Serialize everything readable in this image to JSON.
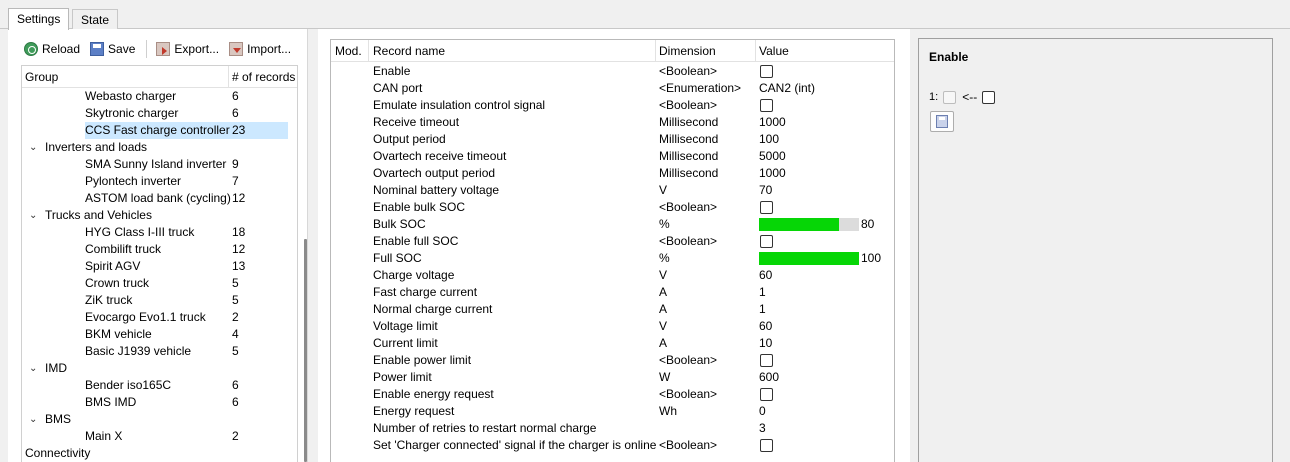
{
  "tabs": [
    {
      "label": "Settings",
      "active": true
    },
    {
      "label": "State",
      "active": false
    }
  ],
  "toolbar": {
    "reload": "Reload",
    "save": "Save",
    "export": "Export...",
    "import": "Import..."
  },
  "tree": {
    "col_group": "Group",
    "col_count": "# of records",
    "rows": [
      {
        "level": 2,
        "label": "Webasto charger",
        "count": "6"
      },
      {
        "level": 2,
        "label": "Skytronic charger",
        "count": "6"
      },
      {
        "level": 2,
        "label": "CCS Fast charge controller",
        "count": "23",
        "selected": true
      },
      {
        "level": 1,
        "label": "Inverters and loads",
        "count": "",
        "expanded": true
      },
      {
        "level": 2,
        "label": "SMA Sunny Island inverter",
        "count": "9"
      },
      {
        "level": 2,
        "label": "Pylontech inverter",
        "count": "7"
      },
      {
        "level": 2,
        "label": "ASTOM load bank (cycling)",
        "count": "12"
      },
      {
        "level": 1,
        "label": "Trucks and Vehicles",
        "count": "",
        "expanded": true
      },
      {
        "level": 2,
        "label": "HYG Class I-III truck",
        "count": "18"
      },
      {
        "level": 2,
        "label": "Combilift truck",
        "count": "12"
      },
      {
        "level": 2,
        "label": "Spirit AGV",
        "count": "13"
      },
      {
        "level": 2,
        "label": "Crown truck",
        "count": "5"
      },
      {
        "level": 2,
        "label": "ZiK truck",
        "count": "5"
      },
      {
        "level": 2,
        "label": "Evocargo Evo1.1 truck",
        "count": "2"
      },
      {
        "level": 2,
        "label": "BKM vehicle",
        "count": "4"
      },
      {
        "level": 2,
        "label": "Basic J1939 vehicle",
        "count": "5"
      },
      {
        "level": 1,
        "label": "IMD",
        "count": "",
        "expanded": true
      },
      {
        "level": 2,
        "label": "Bender iso165C",
        "count": "6"
      },
      {
        "level": 2,
        "label": "BMS IMD",
        "count": "6"
      },
      {
        "level": 1,
        "label": "BMS",
        "count": "",
        "expanded": true
      },
      {
        "level": 2,
        "label": "Main X",
        "count": "2"
      },
      {
        "level": 0,
        "label": "Connectivity",
        "count": "",
        "expanded": true
      }
    ]
  },
  "grid": {
    "col_mod": "Mod.",
    "col_name": "Record name",
    "col_dim": "Dimension",
    "col_value": "Value",
    "rows": [
      {
        "name": "Enable",
        "dim": "<Boolean>",
        "type": "bool",
        "value": ""
      },
      {
        "name": "CAN port",
        "dim": "<Enumeration>",
        "type": "text",
        "value": "CAN2 (int)"
      },
      {
        "name": "Emulate insulation control signal",
        "dim": "<Boolean>",
        "type": "bool",
        "value": ""
      },
      {
        "name": "Receive timeout",
        "dim": "Millisecond",
        "type": "text",
        "value": "1000"
      },
      {
        "name": "Output period",
        "dim": "Millisecond",
        "type": "text",
        "value": "100"
      },
      {
        "name": "Ovartech receive timeout",
        "dim": "Millisecond",
        "type": "text",
        "value": "5000"
      },
      {
        "name": "Ovartech output period",
        "dim": "Millisecond",
        "type": "text",
        "value": "1000"
      },
      {
        "name": "Nominal battery voltage",
        "dim": "V",
        "type": "text",
        "value": "70"
      },
      {
        "name": "Enable bulk SOC",
        "dim": "<Boolean>",
        "type": "bool",
        "value": ""
      },
      {
        "name": "Bulk SOC",
        "dim": "%",
        "type": "bar",
        "value": "80",
        "fraction": 0.8
      },
      {
        "name": "Enable full SOC",
        "dim": "<Boolean>",
        "type": "bool",
        "value": ""
      },
      {
        "name": "Full SOC",
        "dim": "%",
        "type": "bar",
        "value": "100",
        "fraction": 1.0
      },
      {
        "name": "Charge voltage",
        "dim": "V",
        "type": "text",
        "value": "60"
      },
      {
        "name": "Fast charge current",
        "dim": "A",
        "type": "text",
        "value": "1"
      },
      {
        "name": "Normal charge current",
        "dim": "A",
        "type": "text",
        "value": "1"
      },
      {
        "name": "Voltage limit",
        "dim": "V",
        "type": "text",
        "value": "60"
      },
      {
        "name": "Current limit",
        "dim": "A",
        "type": "text",
        "value": "10"
      },
      {
        "name": "Enable power limit",
        "dim": "<Boolean>",
        "type": "bool",
        "value": ""
      },
      {
        "name": "Power limit",
        "dim": "W",
        "type": "text",
        "value": "600"
      },
      {
        "name": "Enable energy request",
        "dim": "<Boolean>",
        "type": "bool",
        "value": ""
      },
      {
        "name": "Energy request",
        "dim": "Wh",
        "type": "text",
        "value": "0"
      },
      {
        "name": "Number of retries to restart normal charge",
        "dim": "",
        "type": "text",
        "value": "3"
      },
      {
        "name": "Set 'Charger connected' signal if the charger is online",
        "dim": "<Boolean>",
        "type": "bool",
        "value": ""
      }
    ]
  },
  "detail": {
    "title": "Enable",
    "index_label": "1:",
    "arrow": "<--"
  },
  "colors": {
    "bar_fill": "#06d606",
    "selection": "#cce8ff"
  }
}
